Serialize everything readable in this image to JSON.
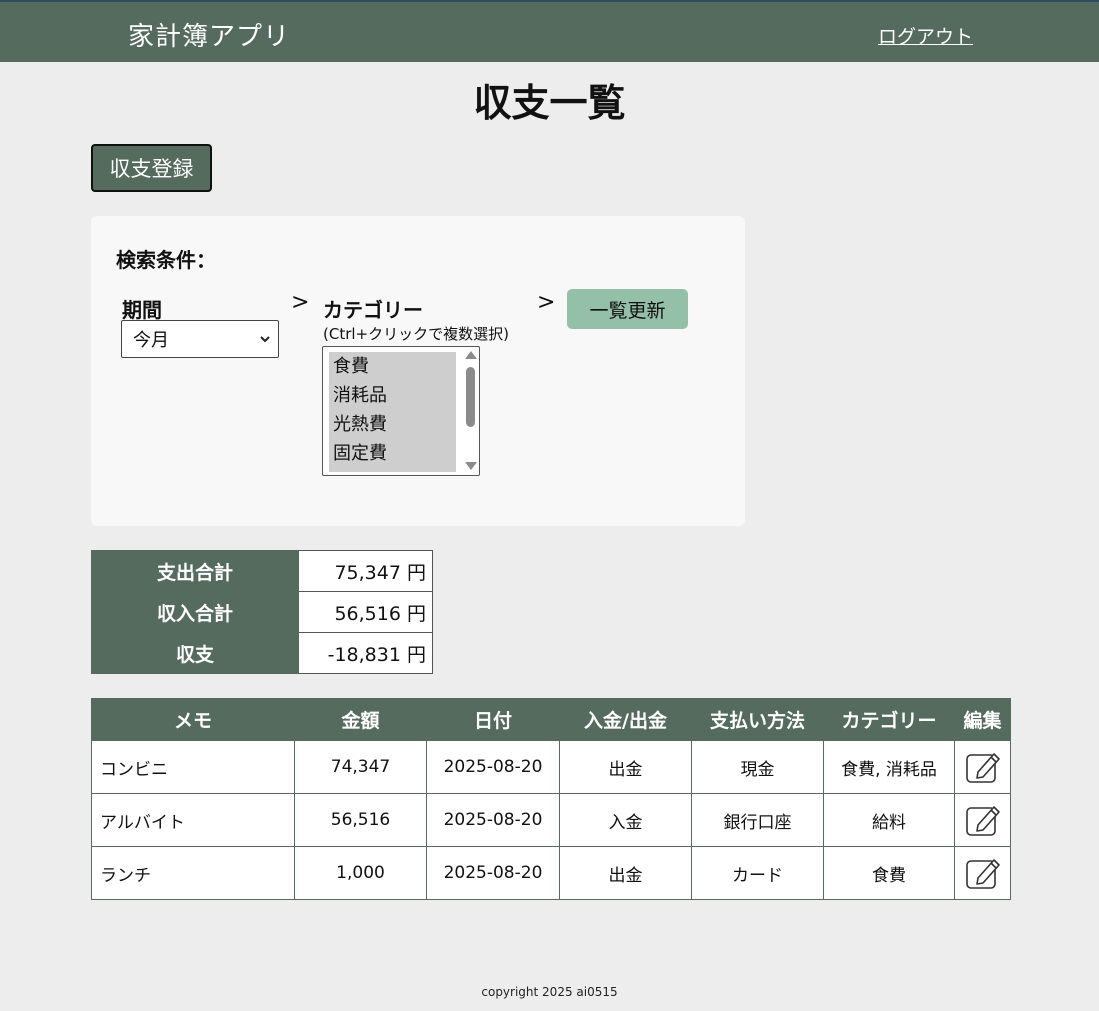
{
  "header": {
    "app_title": "家計簿アプリ",
    "logout_label": "ログアウト"
  },
  "page_title": "収支一覧",
  "register_button_label": "収支登録",
  "search": {
    "heading": "検索条件：",
    "period_label": "期間",
    "period_selected": "今月",
    "arrow": ">",
    "category_label": "カテゴリー",
    "category_hint": "(Ctrl+クリックで複数選択)",
    "category_options": [
      "食費",
      "消耗品",
      "光熱費",
      "固定費"
    ],
    "refresh_label": "一覧更新"
  },
  "summary": [
    {
      "label": "支出合計",
      "value": "75,347 円"
    },
    {
      "label": "収入合計",
      "value": "56,516 円"
    },
    {
      "label": "収支",
      "value": "-18,831 円"
    }
  ],
  "records": {
    "columns": [
      "メモ",
      "金額",
      "日付",
      "入金/出金",
      "支払い方法",
      "カテゴリー",
      "編集"
    ],
    "rows": [
      {
        "memo": "コンビニ",
        "amount": "74,347",
        "date": "2025-08-20",
        "type": "出金",
        "method": "現金",
        "category": "食費, 消耗品"
      },
      {
        "memo": "アルバイト",
        "amount": "56,516",
        "date": "2025-08-20",
        "type": "入金",
        "method": "銀行口座",
        "category": "給料"
      },
      {
        "memo": "ランチ",
        "amount": "1,000",
        "date": "2025-08-20",
        "type": "出金",
        "method": "カード",
        "category": "食費"
      }
    ],
    "edit_icon": "edit-icon"
  },
  "footer": "copyright 2025 ai0515",
  "colors": {
    "header_bg": "#546b5e",
    "accent_button": "#94bfa8",
    "page_bg": "#ededed"
  }
}
